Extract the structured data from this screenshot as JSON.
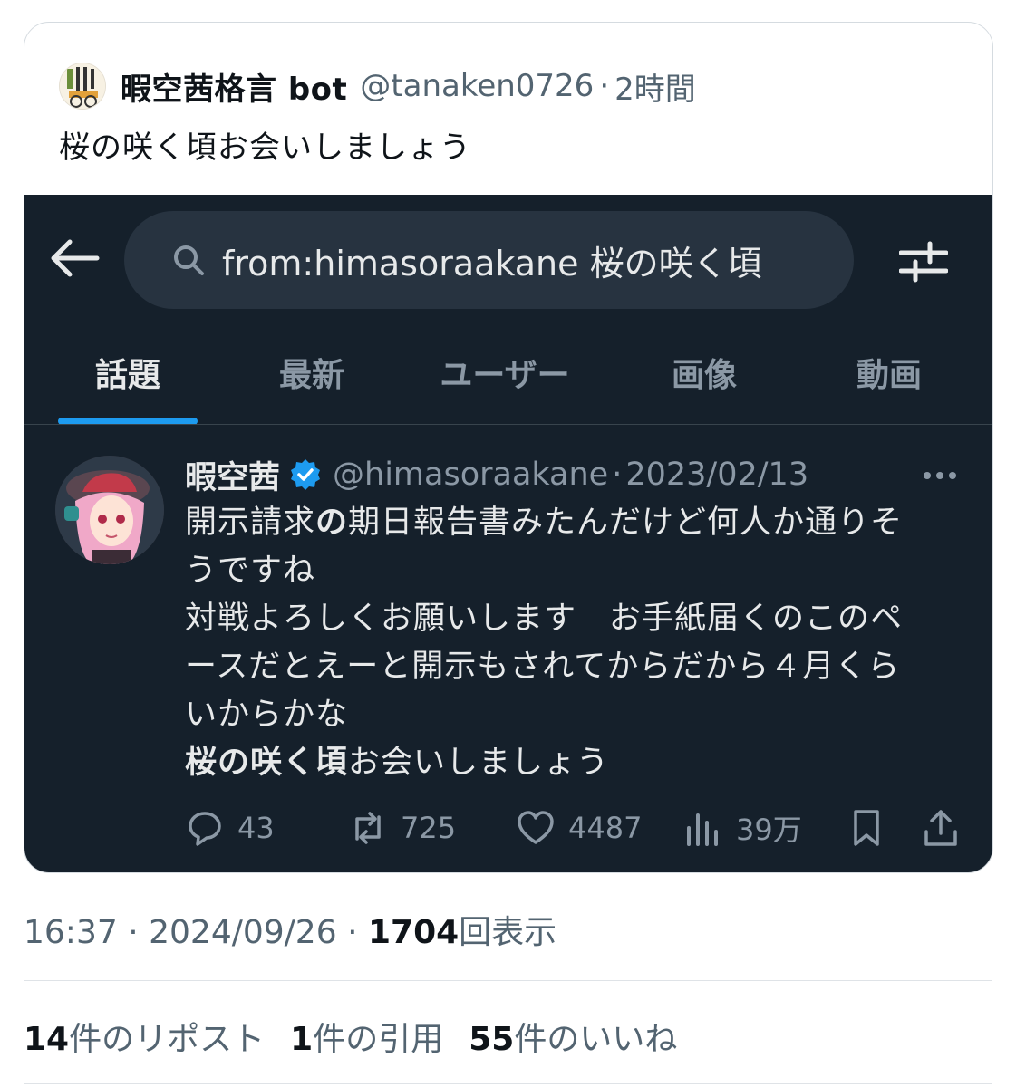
{
  "quote": {
    "display_name": "暇空茜格言 bot",
    "handle": "@tanaken0726",
    "separator": "·",
    "time": "2時間",
    "text": "桜の咲く頃お会いしましょう"
  },
  "screenshot": {
    "search_query": "from:himasoraakane 桜の咲く頃",
    "tabs": [
      "話題",
      "最新",
      "ユーザー",
      "画像",
      "動画"
    ],
    "active_tab": "話題",
    "post": {
      "display_name": "暇空茜",
      "handle": "@himasoraakane",
      "separator": "·",
      "date": "2023/02/13",
      "body": {
        "l1a": "開示請求",
        "l1b": "の",
        "l1c": "期日報告書みたんだけど何人か通りそ",
        "l2": "うですね",
        "l3": "対戦よろしくお願いします　お手紙届くのこのペ",
        "l4": "ースだとえーと開示もされてからだから４月くら",
        "l5": "いからかな",
        "l6a": "桜の咲く頃",
        "l6b": "お会いしましょう"
      },
      "replies": "43",
      "reposts": "725",
      "likes": "4487",
      "views": "39万"
    }
  },
  "meta": {
    "time": "16:37",
    "separator": "·",
    "date": "2024/09/26",
    "views_count": "1704",
    "views_label": "回表示"
  },
  "stats": {
    "reposts_count": "14",
    "reposts_label": "件のリポスト",
    "quotes_count": "1",
    "quotes_label": "件の引用",
    "likes_count": "55",
    "likes_label": "件のいいね"
  },
  "colors": {
    "dark_bg": "#15202b",
    "search_bg": "#273340",
    "accent": "#1d9bf0",
    "muted": "#8b98a5"
  }
}
